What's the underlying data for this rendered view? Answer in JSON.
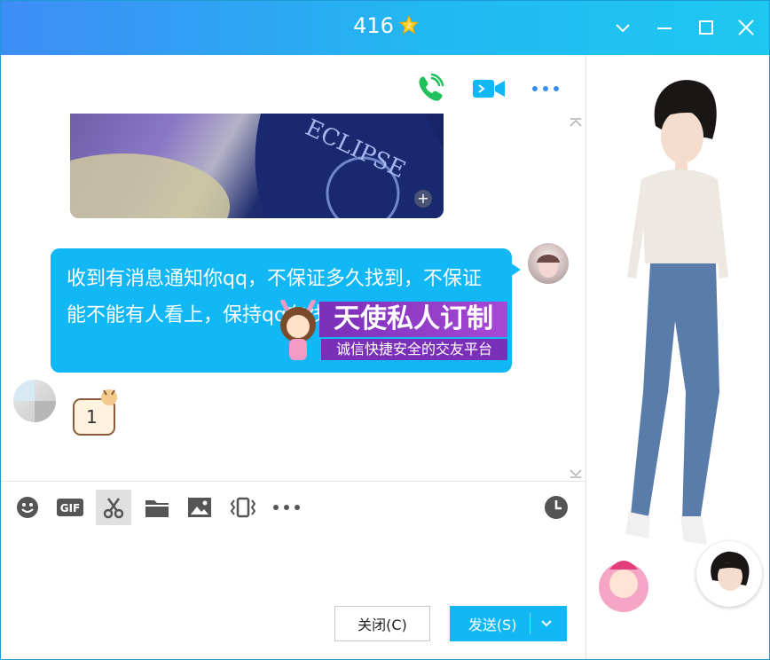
{
  "window": {
    "title": "416"
  },
  "chat": {
    "message_text": "收到有消息通知你qq，不保证多久找到，不保证能不能有人看上，保持qq在线全知上。",
    "sticker_number": "1"
  },
  "ad": {
    "headline": "天使私人订制",
    "tagline": "诚信快捷安全的交友平台"
  },
  "buttons": {
    "close": "关闭(C)",
    "send": "发送(S)"
  },
  "colors": {
    "accent": "#12b7f5",
    "titlebar_start": "#3e8cf5",
    "titlebar_end": "#1ec8f0"
  }
}
